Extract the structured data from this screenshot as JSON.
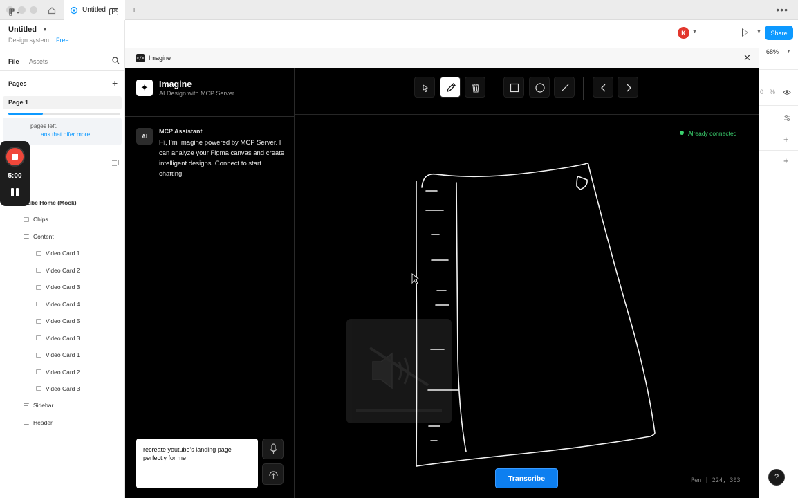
{
  "tab": {
    "title": "Untitled"
  },
  "file": {
    "title": "Untitled",
    "plan_label": "Design system",
    "plan_tier": "Free"
  },
  "sidebar": {
    "tabs": {
      "file": "File",
      "assets": "Assets"
    },
    "pages_label": "Pages",
    "current_page": "Page 1",
    "pages_used_fraction": 0.31,
    "upgrade_line1": "pages left.",
    "upgrade_line2": "ans that offer more",
    "layers": [
      {
        "label": "uTube Home (Mock)",
        "indent": 0
      },
      {
        "label": "Chips",
        "indent": 1
      },
      {
        "label": "Content",
        "indent": 1
      },
      {
        "label": "Video Card 1",
        "indent": 2
      },
      {
        "label": "Video Card 2",
        "indent": 2
      },
      {
        "label": "Video Card 3",
        "indent": 2
      },
      {
        "label": "Video Card 4",
        "indent": 2
      },
      {
        "label": "Video Card 5",
        "indent": 2
      },
      {
        "label": "Video Card 3",
        "indent": 2
      },
      {
        "label": "Video Card 1",
        "indent": 2
      },
      {
        "label": "Video Card 2",
        "indent": 2
      },
      {
        "label": "Video Card 3",
        "indent": 2
      },
      {
        "label": "Sidebar",
        "indent": 1
      },
      {
        "label": "Header",
        "indent": 1
      }
    ]
  },
  "recorder": {
    "time": "5:00"
  },
  "toolbar": {
    "avatar_initial": "K",
    "share_label": "Share",
    "zoom": "68%"
  },
  "right_panel": {
    "partial_pct": "0",
    "pct_symbol": "%"
  },
  "plugin": {
    "window_title": "Imagine",
    "app_name": "Imagine",
    "app_tagline": "AI Design with MCP Server",
    "assistant_avatar": "AI",
    "assistant_name": "MCP Assistant",
    "assistant_message": "Hi, I'm Imagine powered by MCP Server. I can analyze your Figma canvas and create intelligent designs. Connect to start chatting!",
    "input_value": "recreate youtube's landing page perfectly for me",
    "connection_status": "Already connected",
    "transcribe_label": "Transcribe",
    "status_bar": "Pen | 224, 303",
    "help_label": "?"
  },
  "colors": {
    "accent": "#0d99ff",
    "connected": "#3bd16f",
    "record": "#f0473a"
  }
}
